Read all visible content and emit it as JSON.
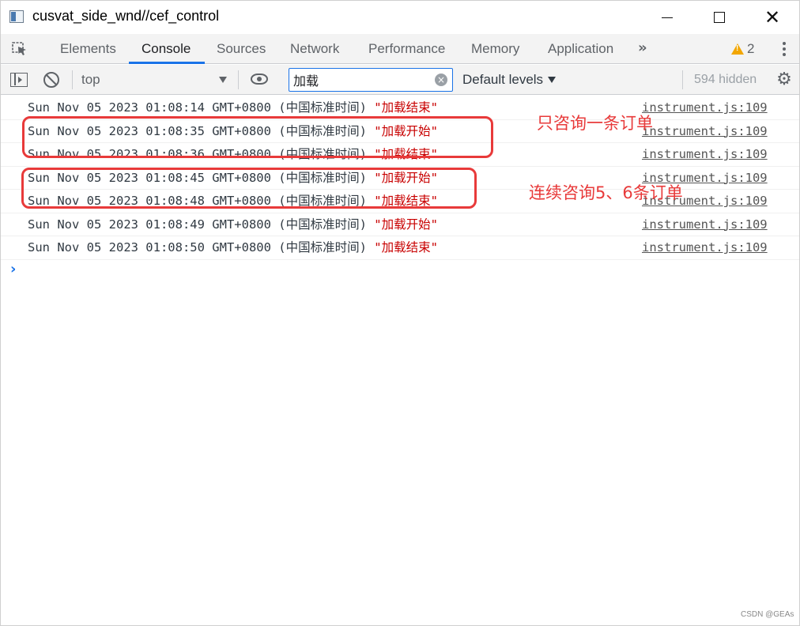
{
  "window": {
    "title": "cusvat_side_wnd//cef_control",
    "close_glyph": "✕"
  },
  "devtools": {
    "tabs": [
      {
        "label": "Elements",
        "active": false
      },
      {
        "label": "Console",
        "active": true
      },
      {
        "label": "Sources",
        "active": false
      },
      {
        "label": "Network",
        "active": false
      },
      {
        "label": "Performance",
        "active": false
      },
      {
        "label": "Memory",
        "active": false
      },
      {
        "label": "Application",
        "active": false
      }
    ],
    "more_tabs": "»",
    "warning_count": "2"
  },
  "console_toolbar": {
    "context": "top",
    "filter_value": "加载",
    "levels": "Default levels",
    "hidden": "594 hidden"
  },
  "messages": [
    {
      "text": "Sun Nov 05 2023 01:08:14 GMT+0800 (中国标准时间) ",
      "string": "\"加载结束\"",
      "source": "instrument.js:109"
    },
    {
      "text": "Sun Nov 05 2023 01:08:35 GMT+0800 (中国标准时间) ",
      "string": "\"加载开始\"",
      "source": "instrument.js:109"
    },
    {
      "text": "Sun Nov 05 2023 01:08:36 GMT+0800 (中国标准时间) ",
      "string": "\"加载结束\"",
      "source": "instrument.js:109"
    },
    {
      "text": "Sun Nov 05 2023 01:08:45 GMT+0800 (中国标准时间) ",
      "string": "\"加载开始\"",
      "source": "instrument.js:109"
    },
    {
      "text": "Sun Nov 05 2023 01:08:48 GMT+0800 (中国标准时间) ",
      "string": "\"加载结束\"",
      "source": "instrument.js:109"
    },
    {
      "text": "Sun Nov 05 2023 01:08:49 GMT+0800 (中国标准时间) ",
      "string": "\"加载开始\"",
      "source": "instrument.js:109"
    },
    {
      "text": "Sun Nov 05 2023 01:08:50 GMT+0800 (中国标准时间) ",
      "string": "\"加载结束\"",
      "source": "instrument.js:109"
    }
  ],
  "prompt": "›",
  "annotations": {
    "note1": "只咨询一条订单",
    "note2": "连续咨询5、6条订单",
    "color": "#e83a3a"
  },
  "watermark": "CSDN @GEAs",
  "colors": {
    "accent": "#1a73e8",
    "string_red": "#c80000",
    "warning": "#f2a600"
  }
}
